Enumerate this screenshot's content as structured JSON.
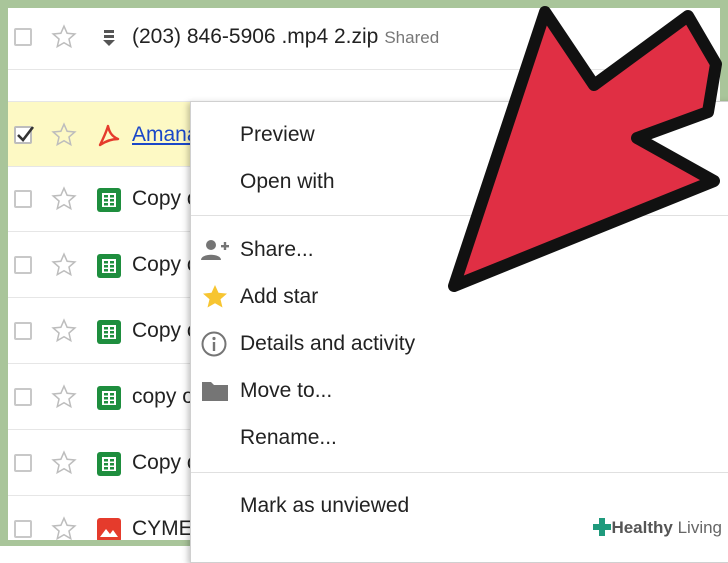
{
  "files": [
    {
      "name": "(203) 846-5906 .mp4 2.zip",
      "tag": "Shared",
      "icon": "zip-icon",
      "checked": false
    },
    {
      "name": "Amana",
      "icon": "pdf-icon",
      "checked": true
    },
    {
      "name": "Copy o",
      "icon": "sheets-icon",
      "checked": false
    },
    {
      "name": "Copy o",
      "icon": "sheets-icon",
      "checked": false
    },
    {
      "name": "Copy o",
      "icon": "sheets-icon",
      "checked": false
    },
    {
      "name": "copy o",
      "icon": "sheets-icon",
      "checked": false
    },
    {
      "name": "Copy o",
      "icon": "sheets-icon",
      "checked": false
    },
    {
      "name": "CYME",
      "icon": "image-icon",
      "checked": false
    }
  ],
  "menu": {
    "preview": "Preview",
    "open_with": "Open with",
    "share": "Share...",
    "add_star": "Add star",
    "details": "Details and activity",
    "move_to": "Move to...",
    "rename": "Rename...",
    "mark_unviewed": "Mark as unviewed"
  },
  "watermark": {
    "brand_bold": "Healthy",
    "brand_rest": " Living"
  },
  "colors": {
    "arrow": "#e02f44",
    "frame": "#a9c59a",
    "sheets": "#1e8e3e",
    "pdf": "#e53b2c",
    "selected_row": "#fdf9c4",
    "link": "#1a47c8"
  }
}
